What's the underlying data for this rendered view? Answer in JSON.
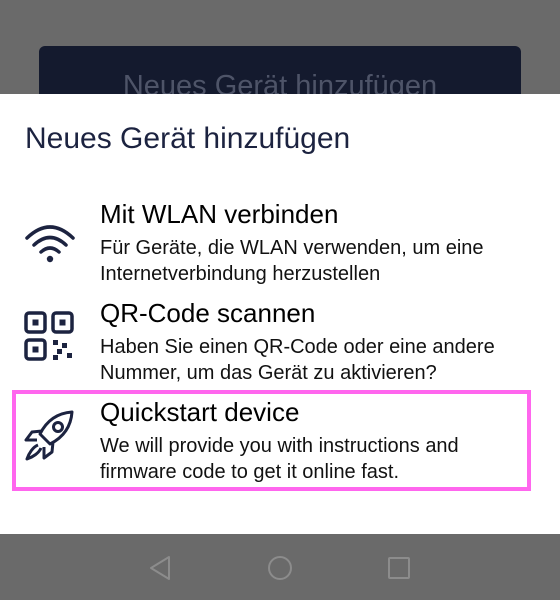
{
  "background": {
    "button_label": "Neues Gerät hinzufügen"
  },
  "dialog": {
    "title": "Neues Gerät hinzufügen",
    "options": [
      {
        "icon": "wifi-icon",
        "title": "Mit WLAN verbinden",
        "description": "Für Geräte, die WLAN verwenden, um eine Internetverbindung herzustellen"
      },
      {
        "icon": "qr-code-icon",
        "title": "QR-Code scannen",
        "description": "Haben Sie einen QR-Code oder eine andere Nummer, um das Gerät zu aktivieren?"
      },
      {
        "icon": "rocket-icon",
        "title": "Quickstart device",
        "description": "We will provide you with instructions and firmware code to get it online fast."
      }
    ],
    "highlighted_option": "Quickstart device"
  },
  "navbar": {
    "buttons": [
      "back-icon",
      "home-icon",
      "recents-icon"
    ]
  },
  "colors": {
    "dialog_title": "#1c2340",
    "icon_stroke": "#1c2340",
    "highlight_border": "#ff66ee",
    "scrim": "#6a6a6a",
    "background_button": "#141a2e"
  }
}
